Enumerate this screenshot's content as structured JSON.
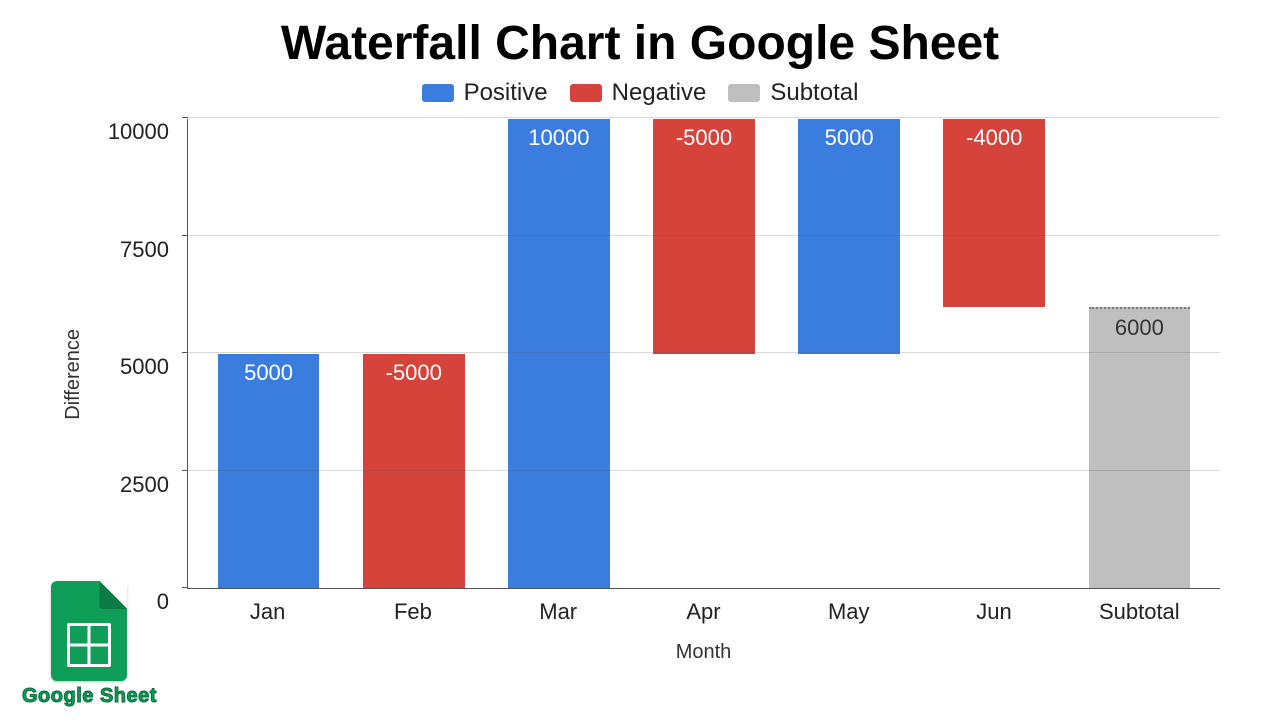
{
  "chart_data": {
    "type": "waterfall",
    "title": "Waterfall Chart in Google Sheet",
    "xlabel": "Month",
    "ylabel": "Difference",
    "ylim": [
      0,
      10000
    ],
    "yticks": [
      0,
      2500,
      5000,
      7500,
      10000
    ],
    "categories": [
      "Jan",
      "Feb",
      "Mar",
      "Apr",
      "May",
      "Jun",
      "Subtotal"
    ],
    "legend": [
      {
        "name": "Positive",
        "color": "#3b7dde"
      },
      {
        "name": "Negative",
        "color": "#d6433a"
      },
      {
        "name": "Subtotal",
        "color": "#bfbfbf"
      }
    ],
    "bars": [
      {
        "label": "Jan",
        "value": 5000,
        "kind": "positive",
        "base": 0,
        "top": 5000,
        "data_label": "5000"
      },
      {
        "label": "Feb",
        "value": -5000,
        "kind": "negative",
        "base": 0,
        "top": 5000,
        "data_label": "-5000"
      },
      {
        "label": "Mar",
        "value": 10000,
        "kind": "positive",
        "base": 0,
        "top": 10000,
        "data_label": "10000"
      },
      {
        "label": "Apr",
        "value": -5000,
        "kind": "negative",
        "base": 5000,
        "top": 10000,
        "data_label": "-5000"
      },
      {
        "label": "May",
        "value": 5000,
        "kind": "positive",
        "base": 5000,
        "top": 10000,
        "data_label": "5000"
      },
      {
        "label": "Jun",
        "value": -4000,
        "kind": "negative",
        "base": 6000,
        "top": 10000,
        "data_label": "-4000"
      },
      {
        "label": "Subtotal",
        "value": 6000,
        "kind": "subtotal",
        "base": 0,
        "top": 6000,
        "data_label": "6000"
      }
    ]
  },
  "logo_text": "Google Sheet"
}
